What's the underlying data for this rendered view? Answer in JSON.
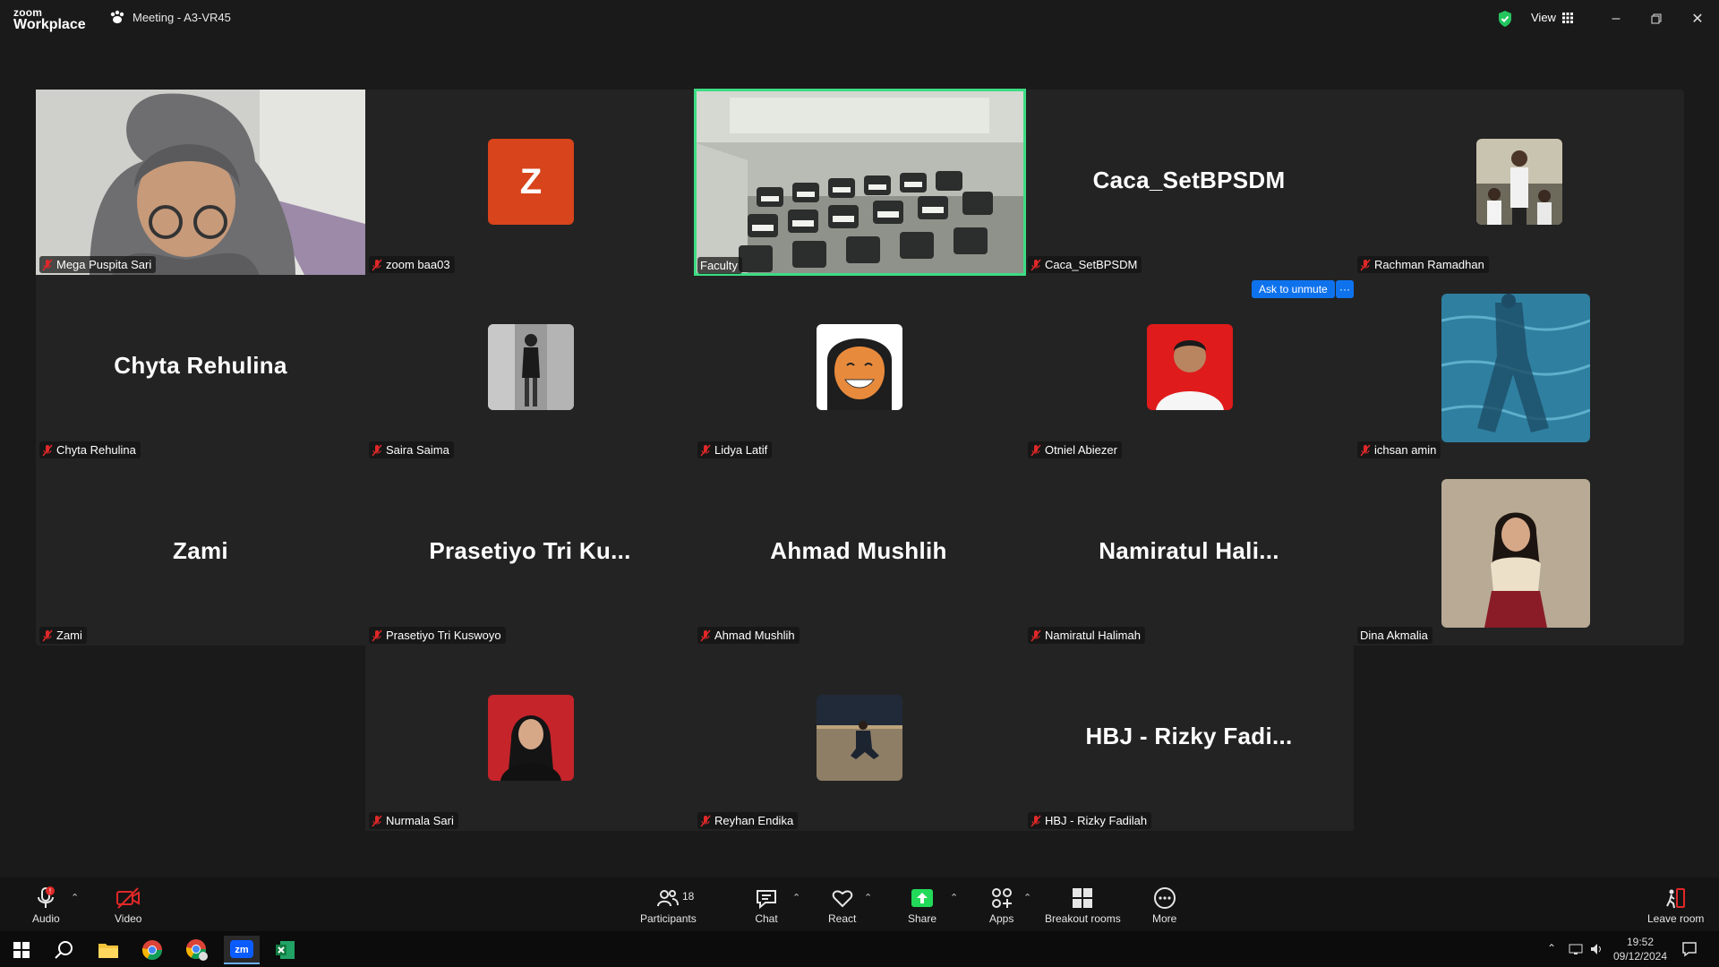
{
  "app": {
    "brand_line1": "zoom",
    "brand_line2": "Workplace",
    "meeting_title": "Meeting - A3-VR45",
    "view_label": "View"
  },
  "participants": [
    {
      "name": "Mega Puspita Sari",
      "type": "video"
    },
    {
      "name": "zoom baa03",
      "type": "letter",
      "letter": "Z",
      "color": "#d8441b"
    },
    {
      "name": "Faculty",
      "type": "video-room",
      "active": true
    },
    {
      "name": "Caca_SetBPSDM",
      "type": "name",
      "display": "Caca_SetBPSDM"
    },
    {
      "name": "Rachman Ramadhan",
      "type": "photo"
    },
    {
      "name": "Chyta Rehulina",
      "type": "name",
      "display": "Chyta Rehulina"
    },
    {
      "name": "Saira Saima",
      "type": "photo"
    },
    {
      "name": "Lidya Latif",
      "type": "photo"
    },
    {
      "name": "Otniel Abiezer",
      "type": "photo"
    },
    {
      "name": "ichsan amin",
      "type": "photo-big"
    },
    {
      "name": "Zami",
      "type": "name",
      "display": "Zami"
    },
    {
      "name": "Prasetiyo Tri Kuswoyo",
      "type": "name",
      "display": "Prasetiyo Tri Ku..."
    },
    {
      "name": "Ahmad Mushlih",
      "type": "name",
      "display": "Ahmad Mushlih"
    },
    {
      "name": "Namiratul Halimah",
      "type": "name",
      "display": "Namiratul Hali..."
    },
    {
      "name": "Dina Akmalia",
      "type": "photo-big"
    },
    {
      "name": "Nurmala Sari",
      "type": "photo"
    },
    {
      "name": "Reyhan Endika",
      "type": "photo"
    },
    {
      "name": "HBJ - Rizky Fadilah",
      "type": "name",
      "display": "HBJ - Rizky Fadi..."
    }
  ],
  "hover_actions": {
    "ask_to_unmute": "Ask to unmute",
    "more": "···"
  },
  "toolbar": {
    "audio": "Audio",
    "video": "Video",
    "participants": "Participants",
    "participants_count": "18",
    "chat": "Chat",
    "react": "React",
    "share": "Share",
    "apps": "Apps",
    "breakout": "Breakout rooms",
    "more": "More",
    "leave": "Leave room"
  },
  "taskbar": {
    "time": "19:52",
    "date": "09/12/2024"
  },
  "colors": {
    "accent_green": "#3ddc84",
    "share_green": "#23d959",
    "zoom_blue": "#0e72ed",
    "muted_red": "#e02828"
  }
}
